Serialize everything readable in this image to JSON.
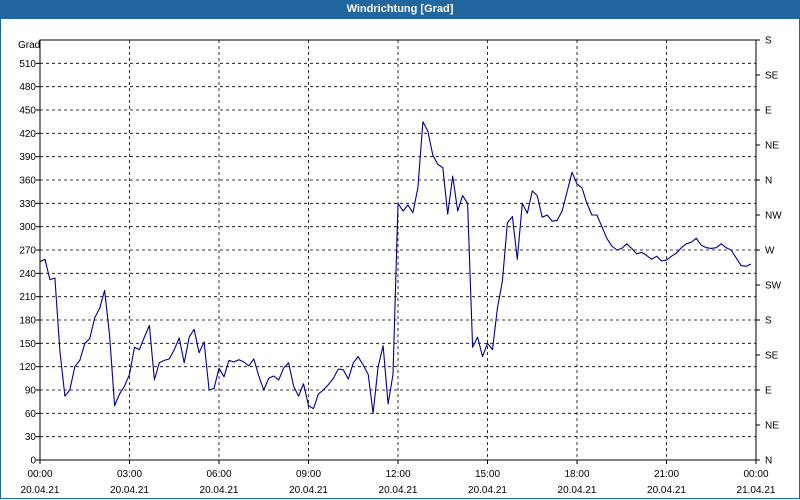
{
  "window": {
    "title": "Windrichtung [Grad]"
  },
  "chart_data": {
    "type": "line",
    "title": "Windrichtung [Grad]",
    "ylabel": "Grad",
    "ylim": [
      0,
      540
    ],
    "yticks": [
      0,
      30,
      60,
      90,
      120,
      150,
      180,
      210,
      240,
      270,
      300,
      330,
      360,
      390,
      420,
      450,
      480,
      510
    ],
    "right_axis_labels": [
      "N",
      "NE",
      "E",
      "SE",
      "S",
      "SW",
      "W",
      "NW",
      "N",
      "NE",
      "E",
      "SE",
      "S"
    ],
    "x_tick_labels": [
      {
        "time": "00:00",
        "date": "20.04.21"
      },
      {
        "time": "03:00",
        "date": "20.04.21"
      },
      {
        "time": "06:00",
        "date": "20.04.21"
      },
      {
        "time": "09:00",
        "date": "20.04.21"
      },
      {
        "time": "12:00",
        "date": "20.04.21"
      },
      {
        "time": "15:00",
        "date": "20.04.21"
      },
      {
        "time": "18:00",
        "date": "20.04.21"
      },
      {
        "time": "21:00",
        "date": "20.04.21"
      },
      {
        "time": "00:00",
        "date": "21.04.21"
      }
    ],
    "grid": true,
    "series": [
      {
        "color": "#00008b",
        "x": [
          "00:00",
          "00:10",
          "00:20",
          "00:30",
          "00:40",
          "00:50",
          "01:00",
          "01:10",
          "01:20",
          "01:30",
          "01:40",
          "01:50",
          "02:00",
          "02:10",
          "02:20",
          "02:30",
          "02:40",
          "02:50",
          "03:00",
          "03:10",
          "03:20",
          "03:30",
          "03:40",
          "03:50",
          "04:00",
          "04:10",
          "04:20",
          "04:30",
          "04:40",
          "04:50",
          "05:00",
          "05:10",
          "05:20",
          "05:30",
          "05:40",
          "05:50",
          "06:00",
          "06:10",
          "06:20",
          "06:30",
          "06:40",
          "06:50",
          "07:00",
          "07:10",
          "07:20",
          "07:30",
          "07:40",
          "07:50",
          "08:00",
          "08:10",
          "08:20",
          "08:30",
          "08:40",
          "08:50",
          "09:00",
          "09:10",
          "09:20",
          "09:30",
          "09:40",
          "09:50",
          "10:00",
          "10:10",
          "10:20",
          "10:30",
          "10:40",
          "10:50",
          "11:00",
          "11:10",
          "11:20",
          "11:30",
          "11:40",
          "11:50",
          "12:00",
          "12:10",
          "12:20",
          "12:30",
          "12:40",
          "12:50",
          "13:00",
          "13:10",
          "13:20",
          "13:30",
          "13:40",
          "13:50",
          "14:00",
          "14:10",
          "14:20",
          "14:30",
          "14:40",
          "14:50",
          "15:00",
          "15:10",
          "15:20",
          "15:30",
          "15:40",
          "15:50",
          "16:00",
          "16:10",
          "16:20",
          "16:30",
          "16:40",
          "16:50",
          "17:00",
          "17:10",
          "17:20",
          "17:30",
          "17:40",
          "17:50",
          "18:00",
          "18:10",
          "18:20",
          "18:30",
          "18:40",
          "18:50",
          "19:00",
          "19:10",
          "19:20",
          "19:30",
          "19:40",
          "19:50",
          "20:00",
          "20:10",
          "20:20",
          "20:30",
          "20:40",
          "20:50",
          "21:00",
          "21:10",
          "21:20",
          "21:30",
          "21:40",
          "21:50",
          "22:00",
          "22:10",
          "22:20",
          "22:30",
          "22:40",
          "22:50",
          "23:00",
          "23:10",
          "23:20",
          "23:30",
          "23:40",
          "23:50"
        ],
        "values": [
          255,
          258,
          232,
          234,
          140,
          82,
          90,
          120,
          128,
          150,
          156,
          183,
          195,
          218,
          160,
          70,
          85,
          95,
          110,
          145,
          142,
          158,
          173,
          103,
          125,
          128,
          130,
          142,
          157,
          125,
          158,
          168,
          138,
          152,
          90,
          92,
          118,
          107,
          128,
          126,
          129,
          126,
          121,
          130,
          108,
          90,
          105,
          108,
          103,
          118,
          125,
          95,
          82,
          98,
          70,
          66,
          85,
          90,
          97,
          105,
          117,
          116,
          104,
          125,
          133,
          122,
          110,
          60,
          120,
          147,
          72,
          110,
          330,
          320,
          328,
          318,
          350,
          435,
          423,
          392,
          380,
          376,
          316,
          365,
          320,
          340,
          330,
          145,
          158,
          133,
          150,
          142,
          195,
          230,
          305,
          313,
          258,
          330,
          317,
          346,
          340,
          312,
          315,
          307,
          308,
          320,
          345,
          370,
          355,
          350,
          330,
          315,
          315,
          300,
          285,
          275,
          270,
          272,
          278,
          272,
          265,
          267,
          263,
          258,
          262,
          256,
          257,
          262,
          266,
          273,
          278,
          280,
          285,
          276,
          273,
          272,
          273,
          278,
          273,
          270,
          260,
          250,
          249,
          252
        ]
      }
    ]
  }
}
